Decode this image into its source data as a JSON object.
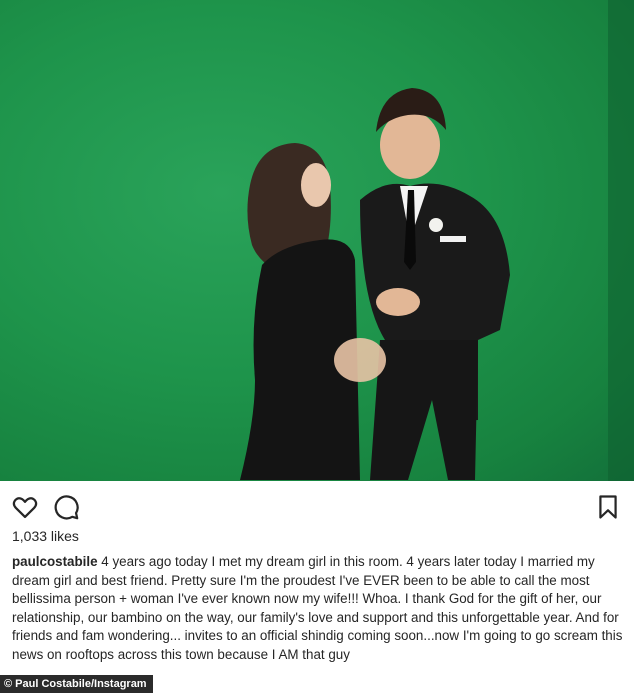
{
  "post": {
    "likes": "1,033 likes",
    "username": "paulcostabile",
    "caption": " 4 years ago today I met my dream girl in this room. 4 years later today I married my dream girl and best friend. Pretty sure I'm the proudest I've EVER been to be able to call the most bellissima person + woman I've ever known now my wife!!! Whoa. I thank God for the gift of her, our relationship, our bambino on the way, our family's love and support and this unforgettable year. And for friends and fam wondering... invites to an official shindig coming soon...now I'm going to go scream this news on rooftops across this town because I AM that guy"
  },
  "icons": {
    "like": "heart-icon",
    "comment": "comment-icon",
    "save": "bookmark-icon"
  },
  "credit": "© Paul Costabile/Instagram",
  "colors": {
    "background_green": "#1e944b",
    "text": "#262626"
  }
}
